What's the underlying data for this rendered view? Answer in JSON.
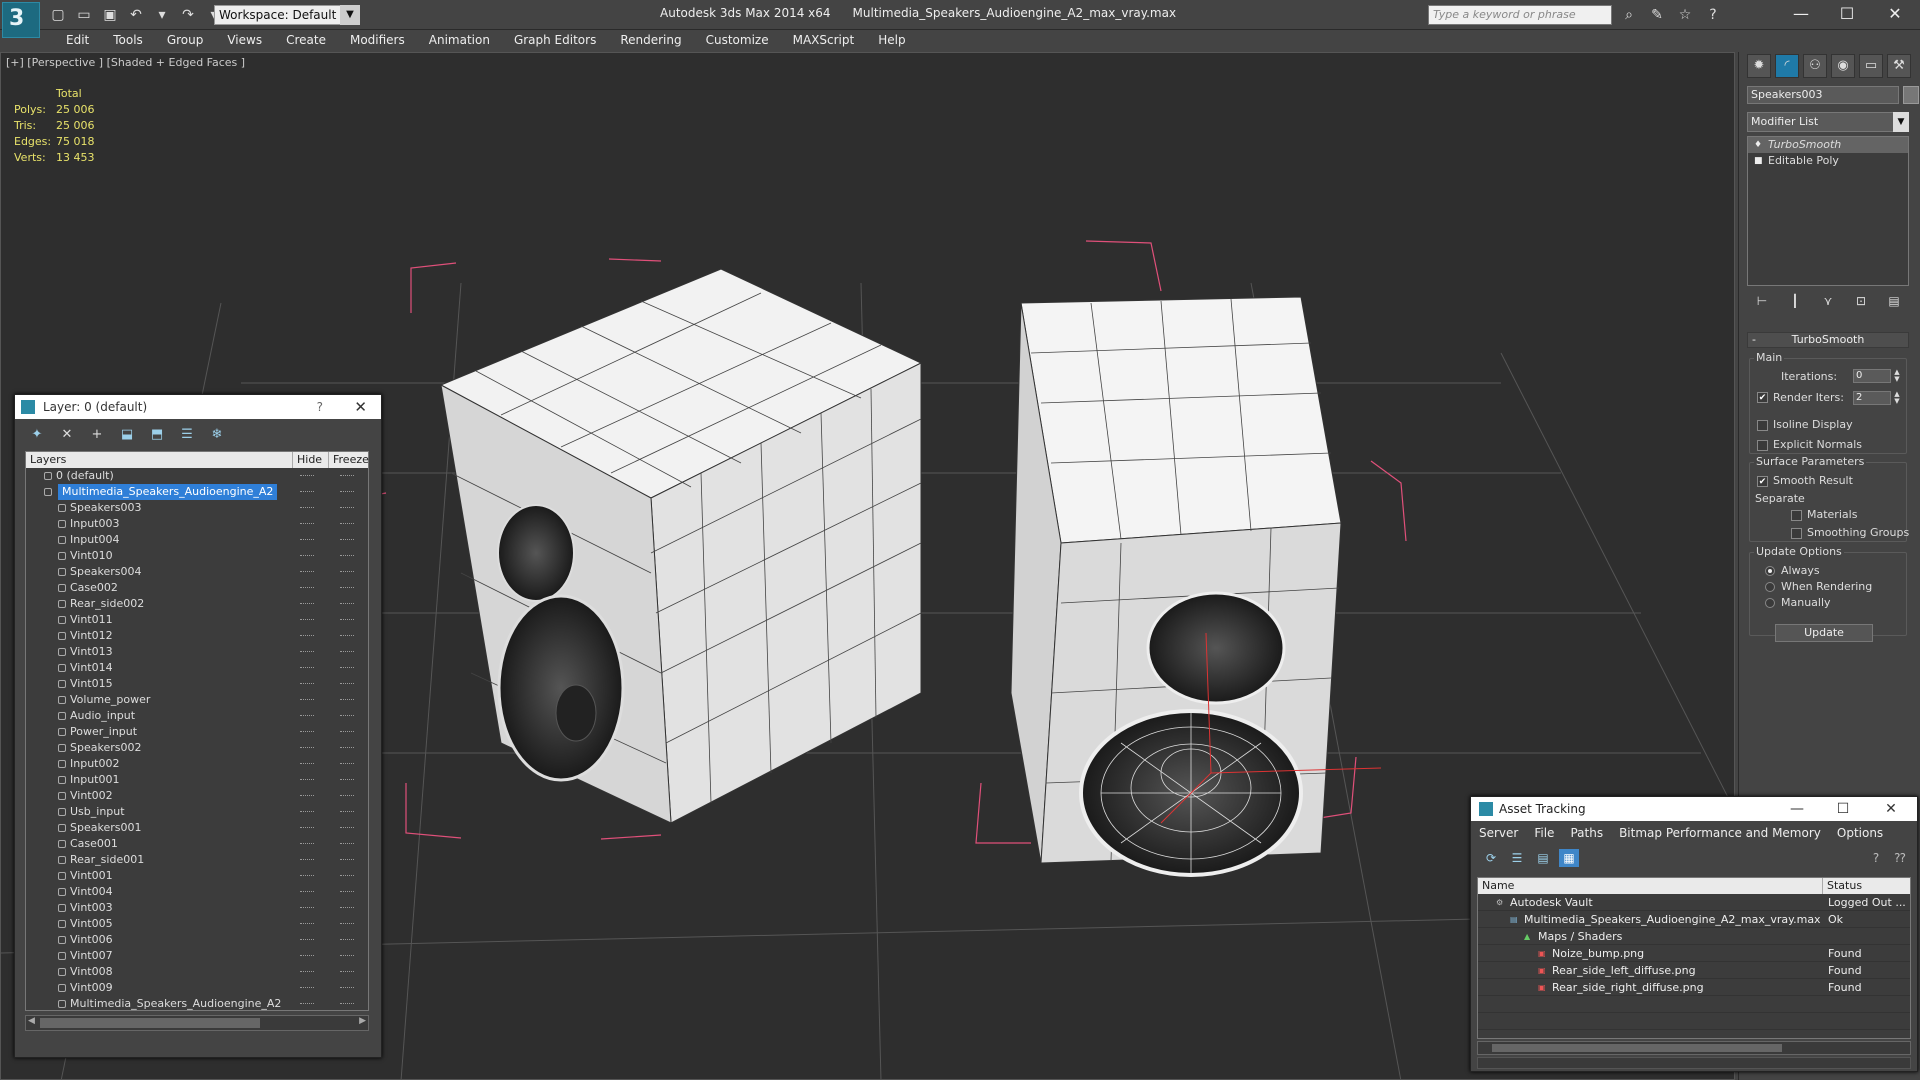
{
  "app": {
    "logo": "3",
    "title": "Autodesk 3ds Max  2014 x64",
    "filename": "Multimedia_Speakers_Audioengine_A2_max_vray.max",
    "workspace": "Workspace: Default",
    "search_placeholder": "Type a keyword or phrase",
    "window_controls": [
      "—",
      "☐",
      "✕"
    ]
  },
  "menu": [
    "Edit",
    "Tools",
    "Group",
    "Views",
    "Create",
    "Modifiers",
    "Animation",
    "Graph Editors",
    "Rendering",
    "Customize",
    "MAXScript",
    "Help"
  ],
  "viewport": {
    "label": "[+] [Perspective ] [Shaded + Edged Faces ]",
    "stats": {
      "header": "Total",
      "rows": [
        {
          "k": "Polys:",
          "v": "25 006"
        },
        {
          "k": "Tris:",
          "v": "25 006"
        },
        {
          "k": "Edges:",
          "v": "75 018"
        },
        {
          "k": "Verts:",
          "v": "13 453"
        }
      ]
    }
  },
  "command_panel": {
    "object_name": "Speakers003",
    "modifier_list": "Modifier List",
    "stack": [
      {
        "label": "TurboSmooth",
        "selected": true
      },
      {
        "label": "Editable Poly",
        "selected": false
      }
    ],
    "rollout_title": "TurboSmooth",
    "main_group": "Main",
    "iterations_label": "Iterations:",
    "iterations_value": "0",
    "render_iters_label": "Render Iters:",
    "render_iters_value": "2",
    "isoline_label": "Isoline Display",
    "explicit_normals_label": "Explicit Normals",
    "surface_group": "Surface Parameters",
    "smooth_result_label": "Smooth Result",
    "separate_label": "Separate",
    "materials_label": "Materials",
    "smoothing_groups_label": "Smoothing Groups",
    "update_group": "Update Options",
    "always_label": "Always",
    "when_rendering_label": "When Rendering",
    "manually_label": "Manually",
    "update_button": "Update"
  },
  "layer_window": {
    "title": "Layer: 0 (default)",
    "help": "?",
    "close": "✕",
    "col_layers": "Layers",
    "col_hide": "Hide",
    "col_freeze": "Freeze",
    "rows": [
      {
        "name": "0 (default)",
        "level": 0
      },
      {
        "name": "Multimedia_Speakers_Audioengine_A2",
        "level": 0,
        "selected": true
      },
      {
        "name": "Speakers003",
        "level": 1
      },
      {
        "name": "Input003",
        "level": 1
      },
      {
        "name": "Input004",
        "level": 1
      },
      {
        "name": "Vint010",
        "level": 1
      },
      {
        "name": "Speakers004",
        "level": 1
      },
      {
        "name": "Case002",
        "level": 1
      },
      {
        "name": "Rear_side002",
        "level": 1
      },
      {
        "name": "Vint011",
        "level": 1
      },
      {
        "name": "Vint012",
        "level": 1
      },
      {
        "name": "Vint013",
        "level": 1
      },
      {
        "name": "Vint014",
        "level": 1
      },
      {
        "name": "Vint015",
        "level": 1
      },
      {
        "name": "Volume_power",
        "level": 1
      },
      {
        "name": "Audio_input",
        "level": 1
      },
      {
        "name": "Power_input",
        "level": 1
      },
      {
        "name": "Speakers002",
        "level": 1
      },
      {
        "name": "Input002",
        "level": 1
      },
      {
        "name": "Input001",
        "level": 1
      },
      {
        "name": "Vint002",
        "level": 1
      },
      {
        "name": "Usb_input",
        "level": 1
      },
      {
        "name": "Speakers001",
        "level": 1
      },
      {
        "name": "Case001",
        "level": 1
      },
      {
        "name": "Rear_side001",
        "level": 1
      },
      {
        "name": "Vint001",
        "level": 1
      },
      {
        "name": "Vint004",
        "level": 1
      },
      {
        "name": "Vint003",
        "level": 1
      },
      {
        "name": "Vint005",
        "level": 1
      },
      {
        "name": "Vint006",
        "level": 1
      },
      {
        "name": "Vint007",
        "level": 1
      },
      {
        "name": "Vint008",
        "level": 1
      },
      {
        "name": "Vint009",
        "level": 1
      },
      {
        "name": "Multimedia_Speakers_Audioengine_A2",
        "level": 1
      }
    ]
  },
  "asset_window": {
    "title": "Asset Tracking",
    "menu": [
      "Server",
      "File",
      "Paths",
      "Bitmap Performance and Memory",
      "Options"
    ],
    "col_name": "Name",
    "col_status": "Status",
    "rows": [
      {
        "name": "Autodesk Vault",
        "status": "Logged Out ...",
        "level": 0,
        "icon": "vault-icon"
      },
      {
        "name": "Multimedia_Speakers_Audioengine_A2_max_vray.max",
        "status": "Ok",
        "level": 1,
        "icon": "max-file-icon"
      },
      {
        "name": "Maps / Shaders",
        "status": "",
        "level": 2,
        "icon": "maps-icon"
      },
      {
        "name": "Noize_bump.png",
        "status": "Found",
        "level": 3,
        "icon": "png-icon"
      },
      {
        "name": "Rear_side_left_diffuse.png",
        "status": "Found",
        "level": 3,
        "icon": "png-icon"
      },
      {
        "name": "Rear_side_right_diffuse.png",
        "status": "Found",
        "level": 3,
        "icon": "png-icon"
      }
    ]
  },
  "colors": {
    "accent": "#1f7aa8",
    "stats": "#e8e26a",
    "selection": "#2f7fd8",
    "bbox": "#e0507a"
  }
}
